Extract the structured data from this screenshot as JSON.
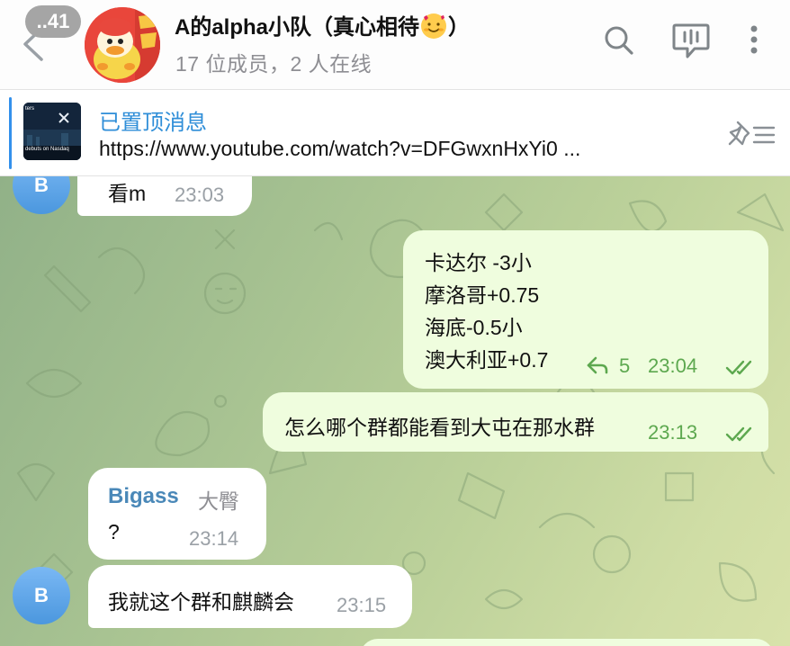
{
  "header": {
    "back_badge": "..41",
    "title_text": "A的alpha小队（真心相待",
    "title_emoji": "smiling-face-with-hearts",
    "title_end": "）",
    "subtitle": "17 位成员，2 人在线",
    "icons": [
      "search-icon",
      "voice-chat-icon",
      "more-vertical-icon"
    ]
  },
  "pinned": {
    "title": "已置顶消息",
    "text": "https://www.youtube.com/watch?v=DFGwxnHxYi0 ...",
    "thumb_top": "ters",
    "thumb_bottom": "debuts on Nasdaq"
  },
  "messages": {
    "m1": {
      "text": "看m",
      "time": "23:03",
      "avatar": "B"
    },
    "m2": {
      "lines": [
        "卡达尔 -3小",
        "摩洛哥+0.75",
        "海底-0.5小",
        "澳大利亚+0.7"
      ],
      "reply_count": "5",
      "time": "23:04"
    },
    "m3": {
      "text": "怎么哪个群都能看到大屯在那水群",
      "time": "23:13"
    },
    "m4": {
      "sender": "Bigass",
      "rank": "大臀",
      "text": "?",
      "time": "23:14"
    },
    "m5": {
      "text": "我就这个群和麒麟会",
      "time": "23:15",
      "avatar": "B"
    }
  },
  "colors": {
    "accent": "#3390ec",
    "sender": "#4a88b8",
    "outgoing_bubble": "#effdde",
    "outgoing_meta": "#5da84f",
    "chat_bg_start": "#91b188",
    "chat_bg_end": "#d8e2aa"
  }
}
